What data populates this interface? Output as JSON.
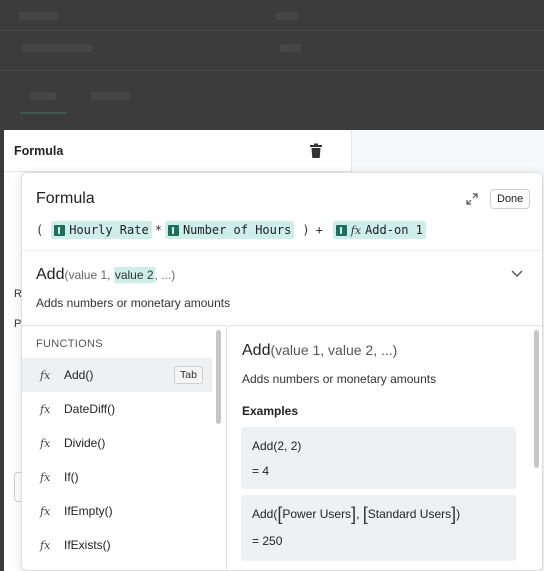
{
  "panel": {
    "title": "Formula",
    "stub_r": "R",
    "stub_p": "P"
  },
  "popup": {
    "title": "Formula",
    "done_label": "Done",
    "expression": {
      "open_paren": "(",
      "token1": "Hourly Rate",
      "op_multiply": "*",
      "token2": "Number of Hours",
      "close_paren": ")",
      "op_plus": "+",
      "fx_symbol": "fx",
      "token3": "Add-on 1"
    },
    "signature": {
      "name": "Add",
      "open": "(value 1, ",
      "highlight": "value 2",
      "close": ", ...)",
      "description": "Adds numbers or monetary amounts"
    }
  },
  "functions": {
    "heading": "FUNCTIONS",
    "fx_symbol": "fx",
    "tab_hint": "Tab",
    "items": [
      {
        "label": "Add()"
      },
      {
        "label": "DateDiff()"
      },
      {
        "label": "Divide()"
      },
      {
        "label": "If()"
      },
      {
        "label": "IfEmpty()"
      },
      {
        "label": "IfExists()"
      }
    ]
  },
  "detail": {
    "name": "Add",
    "args": "(value 1, value 2, ...)",
    "description": "Adds numbers or monetary amounts",
    "examples_heading": "Examples",
    "example1": {
      "expr": "Add(2, 2)",
      "result": "= 4"
    },
    "example2": {
      "prefix": "Add(",
      "ref1": "Power Users",
      "sep": ", ",
      "ref2": "Standard Users",
      "suffix": ")",
      "result": "= 250"
    }
  },
  "colors": {
    "accent_highlight": "#cdeee9",
    "pill_icon": "#1f6f5c",
    "selected_row": "#eef0f2"
  },
  "icons": [
    "trash-icon",
    "expand-icon",
    "chevron-down-icon",
    "fx-icon"
  ]
}
